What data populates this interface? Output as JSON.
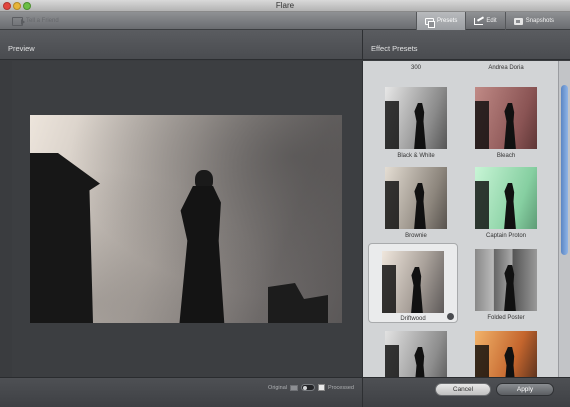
{
  "window": {
    "title": "Flare"
  },
  "toolbar": {
    "share_label": "Tell a Friend",
    "tabs": [
      {
        "label": "Presets",
        "icon": "presets-icon",
        "active": true
      },
      {
        "label": "Edit",
        "icon": "edit-icon",
        "active": false
      },
      {
        "label": "Snapshots",
        "icon": "snapshots-icon",
        "active": false
      }
    ]
  },
  "preview": {
    "title": "Preview",
    "compare": {
      "original_label": "Original",
      "processed_label": "Processed"
    }
  },
  "presets": {
    "title": "Effect Presets",
    "items": [
      {
        "label": "300"
      },
      {
        "label": "Andrea Doria"
      },
      {
        "label": "Black & White"
      },
      {
        "label": "Bleach"
      },
      {
        "label": "Brownie"
      },
      {
        "label": "Captain Proton"
      },
      {
        "label": "Driftwood",
        "selected": true
      },
      {
        "label": "Folded Poster"
      },
      {
        "label": ""
      },
      {
        "label": ""
      }
    ]
  },
  "actions": {
    "cancel_label": "Cancel",
    "apply_label": "Apply"
  },
  "colors": {
    "scroll_thumb": "#6f9ad6",
    "captain_proton_tint": "#8fe0b0",
    "bleach_tint": "#a04848"
  }
}
